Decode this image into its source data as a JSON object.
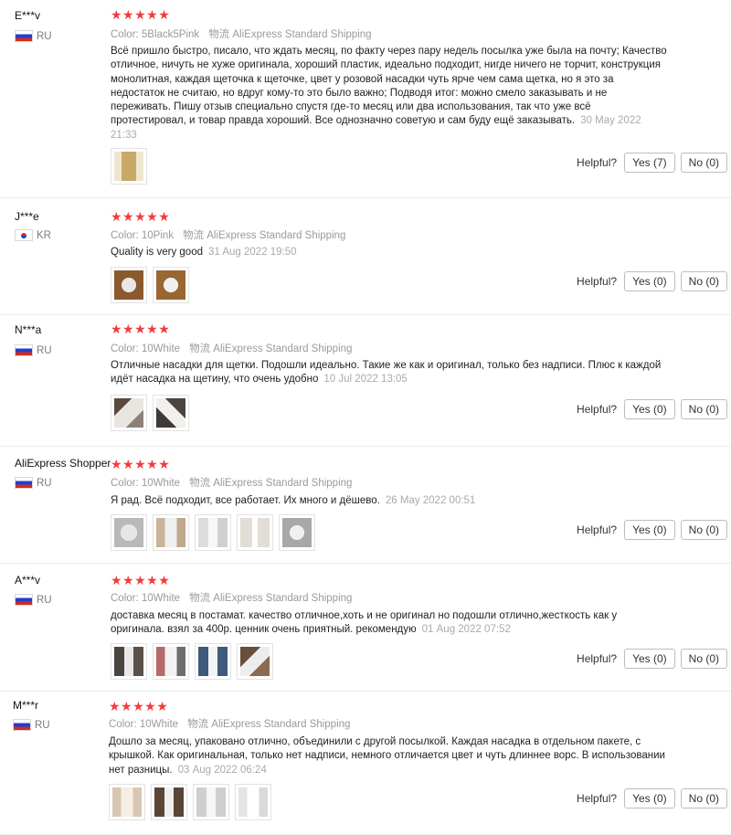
{
  "ui": {
    "color_label": "Color:",
    "shipping_label": "物流",
    "helpful_label": "Helpful?",
    "star_glyphs": "★★★★★",
    "star_color": "#f23c3c"
  },
  "reviews": [
    {
      "user": "E***v",
      "country": "RU",
      "color": "5Black5Pink",
      "shipping": "AliExpress Standard Shipping",
      "text": "Всё пришло быстро, писало, что ждать месяц, по факту через пару недель посылка уже была на почту; Качество отличное, ничуть не хуже оригинала, хороший пластик, идеально подходит, нигде ничего не торчит, конструкция монолитная, каждая щеточка к щеточке, цвет у розовой насадки чуть ярче чем сама щетка, но я это за недостаток не считаю, но вдруг кому-то это было важно; Подводя итог: можно смело заказывать и не переживать. Пишу отзыв специально спустя где-то месяц или два использования, так что уже всё протестировал, и товар правда хороший. Все однозначно советую и сам буду ещё заказывать.",
      "date": "30 May 2022 21:33",
      "yes": "Yes (7)",
      "no": "No (0)"
    },
    {
      "user": "J***e",
      "country": "KR",
      "color": "10Pink",
      "shipping": "AliExpress Standard Shipping",
      "text": "Quality is very good",
      "date": "31 Aug 2022 19:50",
      "yes": "Yes (0)",
      "no": "No (0)"
    },
    {
      "user": "N***a",
      "country": "RU",
      "color": "10White",
      "shipping": "AliExpress Standard Shipping",
      "text": "Отличные насадки для щетки. Подошли идеально. Такие же как и оригинал, только без надписи. Плюс к каждой идёт насадка на щетину, что очень удобно",
      "date": "10 Jul 2022 13:05",
      "yes": "Yes (0)",
      "no": "No (0)"
    },
    {
      "user": "AliExpress Shopper",
      "country": "RU",
      "color": "10White",
      "shipping": "AliExpress Standard Shipping",
      "text": "Я рад. Всё подходит, все работает. Их много и дёшево.",
      "date": "26 May 2022 00:51",
      "yes": "Yes (0)",
      "no": "No (0)"
    },
    {
      "user": "A***v",
      "country": "RU",
      "color": "10White",
      "shipping": "AliExpress Standard Shipping",
      "text": "доставка месяц в постамат. качество отличное,хоть и не оригинал но подошли отлично,жесткость как у оригинала. взял за 400р. ценник очень приятный. рекомендую",
      "date": "01 Aug 2022 07:52",
      "yes": "Yes (0)",
      "no": "No (0)"
    },
    {
      "user": "M***r",
      "country": "RU",
      "color": "10White",
      "shipping": "AliExpress Standard Shipping",
      "text": "Дошло за месяц, упаковано отлично, объединили с другой посылкой. Каждая насадка в отдельном пакете, с крышкой. Как оригинальная, только нет надписи, немного отличается цвет и чуть длиннее ворс. В использовании нет разницы.",
      "date": "03 Aug 2022 06:24",
      "yes": "Yes (0)",
      "no": "No (0)"
    }
  ]
}
